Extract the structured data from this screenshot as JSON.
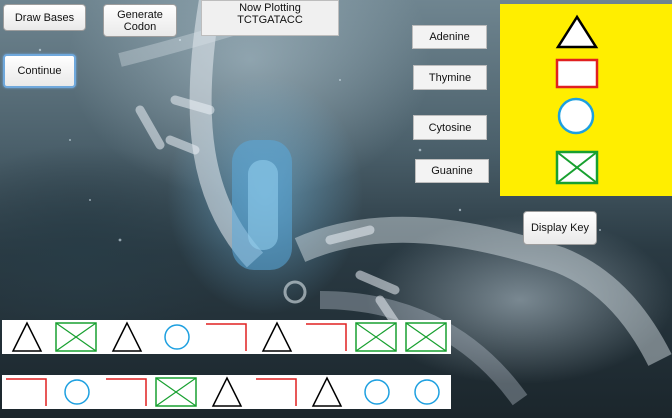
{
  "buttons": {
    "draw_bases": "Draw Bases",
    "generate_codon": "Generate Codon",
    "continue": "Continue",
    "display_key": "Display Key"
  },
  "plot_status": {
    "line1": "Now Plotting",
    "line2": "TCTGATACC"
  },
  "base_labels": {
    "adenine": "Adenine",
    "thymine": "Thymine",
    "cytosine": "Cytosine",
    "guanine": "Guanine"
  },
  "key_symbols": [
    {
      "base": "adenine",
      "icon": "triangle-icon",
      "color": "#000000"
    },
    {
      "base": "thymine",
      "icon": "square-icon",
      "color": "#e02020"
    },
    {
      "base": "cytosine",
      "icon": "circle-icon",
      "color": "#1ea0e0"
    },
    {
      "base": "guanine",
      "icon": "crossed-box-icon",
      "color": "#18a030"
    }
  ],
  "strand_top": [
    "triangle",
    "crossed-box",
    "triangle",
    "circle",
    "square",
    "triangle",
    "square",
    "crossed-box",
    "crossed-box"
  ],
  "strand_bottom": [
    "square",
    "circle",
    "square",
    "crossed-box",
    "triangle",
    "square",
    "triangle",
    "circle",
    "circle"
  ],
  "colors": {
    "key_background": "#ffee00",
    "triangle": "#000000",
    "square": "#e02020",
    "circle": "#1ea0e0",
    "crossed_box": "#18a030"
  }
}
